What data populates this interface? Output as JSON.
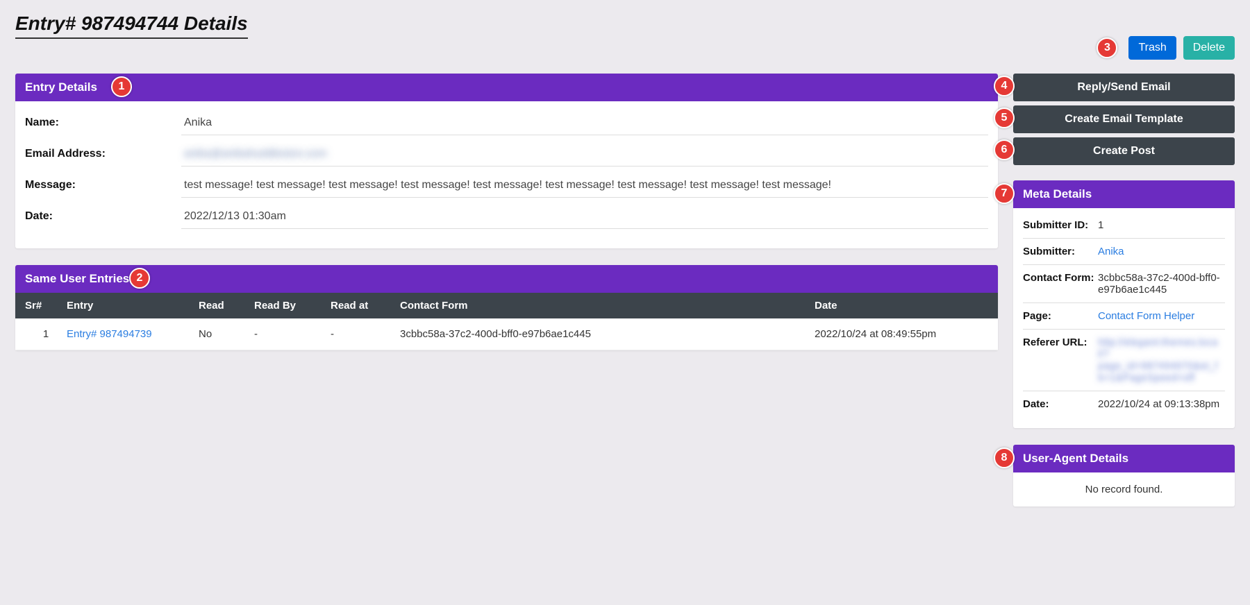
{
  "page": {
    "title": "Entry# 987494744 Details"
  },
  "top_buttons": {
    "trash": "Trash",
    "delete": "Delete"
  },
  "badges": {
    "b1": "1",
    "b2": "2",
    "b3": "3",
    "b4": "4",
    "b5": "5",
    "b6": "6",
    "b7": "7",
    "b8": "8"
  },
  "entry_panel": {
    "header": "Entry Details",
    "fields": {
      "name_label": "Name:",
      "name_value": "Anika",
      "email_label": "Email Address:",
      "email_value": "anika@anikahuddleston.com",
      "message_label": "Message:",
      "message_value": "test message! test message! test message! test message! test message! test message! test message! test message! test message!",
      "date_label": "Date:",
      "date_value": "2022/12/13 01:30am"
    }
  },
  "actions": {
    "reply": "Reply/Send Email",
    "template": "Create Email Template",
    "post": "Create Post"
  },
  "same_user_panel": {
    "header": "Same User Entries",
    "cols": {
      "sr": "Sr#",
      "entry": "Entry",
      "read": "Read",
      "readby": "Read By",
      "readat": "Read at",
      "form": "Contact Form",
      "date": "Date"
    },
    "row": {
      "sr": "1",
      "entry": "Entry# 987494739",
      "read": "No",
      "readby": "-",
      "readat": "-",
      "form": "3cbbc58a-37c2-400d-bff0-e97b6ae1c445",
      "date": "2022/10/24 at 08:49:55pm"
    }
  },
  "meta_panel": {
    "header": "Meta Details",
    "rows": {
      "subid_label": "Submitter ID:",
      "subid_val": "1",
      "sub_label": "Submitter:",
      "sub_val": "Anika",
      "cf_label": "Contact Form:",
      "cf_val": "3cbbc58a-37c2-400d-bff0-e97b6ae1c445",
      "page_label": "Page:",
      "page_val": "Contact Form Helper",
      "ref_label": "Referer URL:",
      "ref_val": "http://elegant-themes.loca l/?page_id=987494670&et_f b=1&PageSpeed=off",
      "date_label": "Date:",
      "date_val": "2022/10/24 at 09:13:38pm"
    }
  },
  "ua_panel": {
    "header": "User-Agent Details",
    "body": "No record found."
  }
}
